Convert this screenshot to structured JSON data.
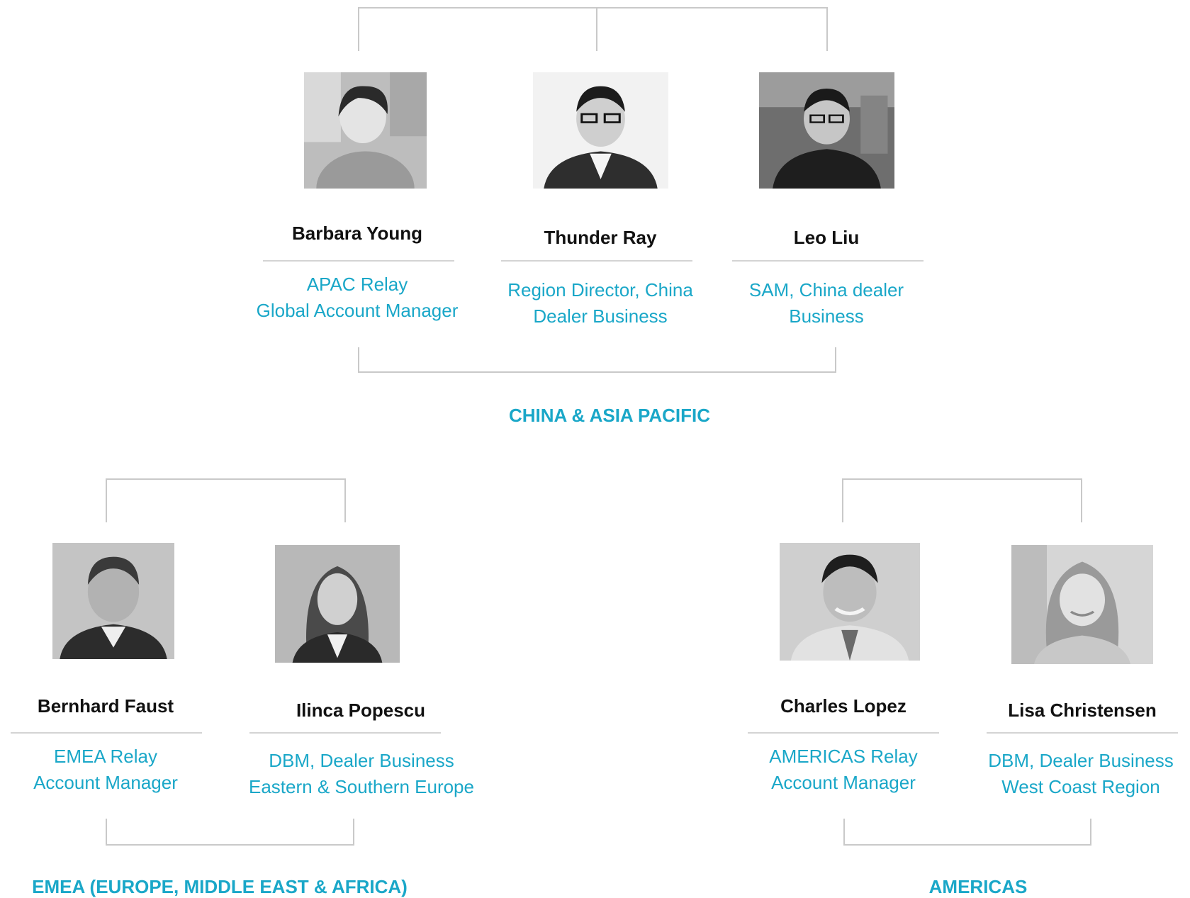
{
  "accent_color": "#1aa7c8",
  "connector_color": "#c9c9c9",
  "regions": {
    "apac": {
      "label": "CHINA & ASIA PACIFIC"
    },
    "emea": {
      "label": "EMEA (EUROPE, MIDDLE EAST & AFRICA)"
    },
    "americas": {
      "label": "AMERICAS"
    }
  },
  "people": {
    "barbara": {
      "name": "Barbara Young",
      "role_line1": "APAC Relay",
      "role_line2": "Global Account Manager"
    },
    "thunder": {
      "name": "Thunder Ray",
      "role_line1": "Region Director, China",
      "role_line2": "Dealer Business"
    },
    "leo": {
      "name": "Leo Liu",
      "role_line1": "SAM, China dealer",
      "role_line2": "Business"
    },
    "bernhard": {
      "name": "Bernhard Faust",
      "role_line1": "EMEA Relay",
      "role_line2": "Account Manager"
    },
    "ilinca": {
      "name": "Ilinca Popescu",
      "role_line1": "DBM, Dealer Business",
      "role_line2": "Eastern & Southern Europe"
    },
    "charles": {
      "name": "Charles Lopez",
      "role_line1": "AMERICAS Relay",
      "role_line2": "Account Manager"
    },
    "lisa": {
      "name": "Lisa Christensen",
      "role_line1": "DBM, Dealer Business",
      "role_line2": "West Coast Region"
    }
  }
}
